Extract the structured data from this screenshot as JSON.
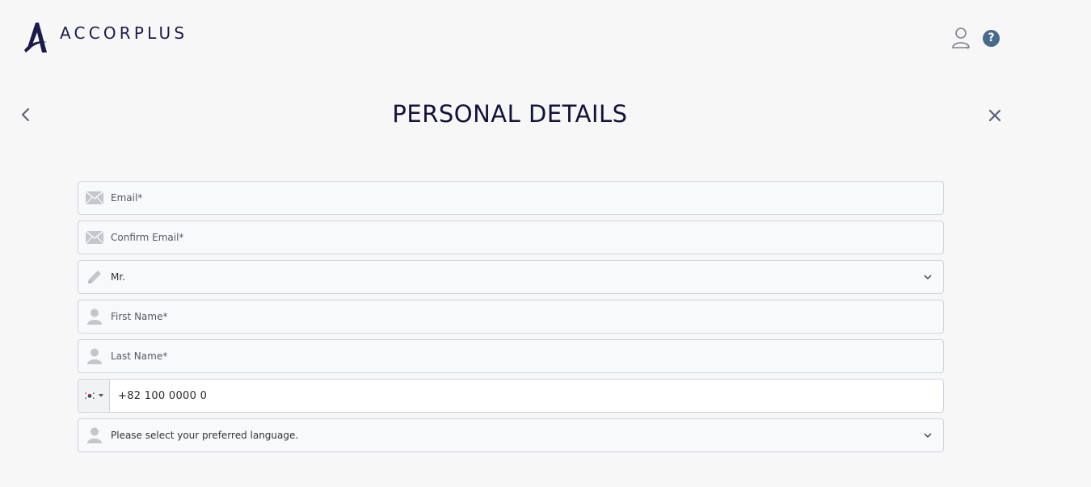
{
  "header": {
    "brand": "ACCORPLUS"
  },
  "page": {
    "title": "PERSONAL DETAILS"
  },
  "form": {
    "email_placeholder": "Email*",
    "confirm_email_placeholder": "Confirm Email*",
    "title_selected": "Mr.",
    "first_name_placeholder": "First Name*",
    "last_name_placeholder": "Last Name*",
    "phone_country": "KR",
    "phone_value": "+82 100 0000 0",
    "language_selected": "Please select your preferred language."
  },
  "icons": {
    "back": "chevron-left-icon",
    "close": "close-icon",
    "user": "user-icon",
    "help": "question-icon",
    "email": "envelope-icon",
    "title": "pencil-icon",
    "person": "person-icon",
    "chevron": "chevron-down-icon"
  },
  "colors": {
    "brand_navy": "#1b1b4b",
    "help_blue": "#4a6a8c",
    "icon_gray": "#c4c6cc"
  }
}
